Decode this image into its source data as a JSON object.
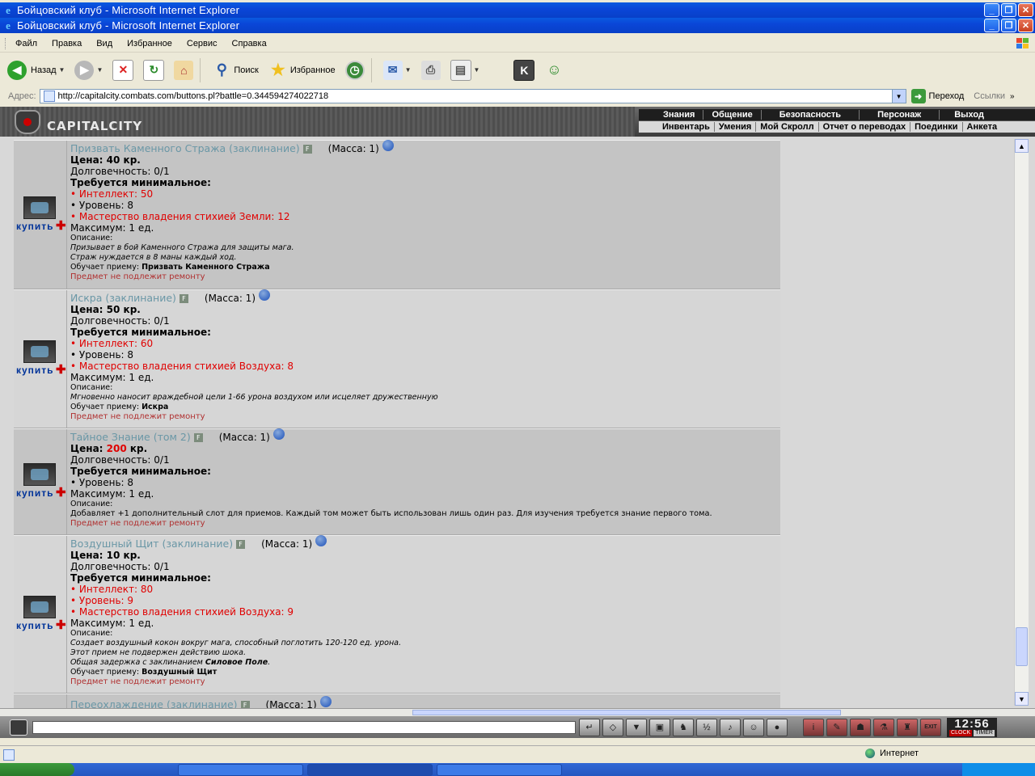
{
  "window": {
    "title1": "Бойцовский клуб - Microsoft Internet Explorer",
    "title2": "Бойцовский клуб - Microsoft Internet Explorer"
  },
  "menu": [
    "Файл",
    "Правка",
    "Вид",
    "Избранное",
    "Сервис",
    "Справка"
  ],
  "toolbar": {
    "back": "Назад",
    "search": "Поиск",
    "favorites": "Избранное"
  },
  "address": {
    "label": "Адрес:",
    "url": "http://capitalcity.combats.com/buttons.pl?battle=0.344594274022718",
    "go": "Переход",
    "links": "Ссылки"
  },
  "game": {
    "logo": "CAPITALCITY",
    "nav_top": [
      "Знания",
      "Общение",
      "Безопасность",
      "Персонаж",
      "Выход"
    ],
    "nav_bottom": [
      "Инвентарь",
      "Умения",
      "Мой Скролл",
      "Отчет о переводах",
      "Поединки",
      "Анкета"
    ]
  },
  "labels": {
    "buy": "купить",
    "mass": "(Масса: 1)",
    "price": "Цена:",
    "currency": "кр.",
    "durability": "Долговечность: 0/1",
    "required": "Требуется минимальное:",
    "max": "Максимум: 1 ед.",
    "description": "Описание:",
    "teaches": "Обучает приему:",
    "no_repair": "Предмет не подлежит ремонту",
    "f_badge": "F"
  },
  "items": [
    {
      "name": "Призвать Каменного Стража (заклинание)",
      "price": "40",
      "req1": "• Интеллект: 50",
      "req2": "• Уровень: 8",
      "req3": "• Мастерство владения стихией Земли: 12",
      "desc1": "Призывает в бой Каменного Стража для защиты мага.",
      "desc2": "Страж нуждается в 8 маны каждый ход.",
      "teaches": "Призвать Каменного Стража"
    },
    {
      "name": "Искра (заклинание)",
      "price": "50",
      "req1": "• Интеллект: 60",
      "req2": "• Уровень: 8",
      "req3": "• Мастерство владения стихией Воздуха: 8",
      "desc1": "Мгновенно наносит враждебной цели 1-66 урона воздухом или исцеляет дружественную",
      "teaches": "Искра"
    },
    {
      "name": "Тайное Знание (том 2)",
      "price": "200",
      "req1": "• Уровень: 8",
      "desc1": "Добавляет +1 дополнительный слот для приемов. Каждый том может быть использован лишь один раз. Для изучения требуется знание первого тома."
    },
    {
      "name": "Воздушный Щит (заклинание)",
      "price": "10",
      "req1": "• Интеллект: 80",
      "req2": "• Уровень: 9",
      "req3": "• Мастерство владения стихией Воздуха: 9",
      "desc1": "Создает воздушный кокон вокруг мага, способный поглотить 120-120 ед. урона.",
      "desc2": "Этот прием не подвержен действию шока.",
      "desc3_prefix": "Общая задержка с заклинанием",
      "desc3_bold": "Силовое Поле",
      "desc3_suffix": ".",
      "teaches": "Воздушный Щит"
    },
    {
      "name": "Переохлаждение (заклинание)"
    }
  ],
  "chat": {
    "exit": "EXIT",
    "time": "12:56",
    "clock": "CLOCK",
    "timer": "TIMER"
  },
  "status": {
    "zone": "Интернет"
  },
  "colors": {
    "title_bar": "#0a46d8",
    "item_link": "#6a97a6",
    "requirement_red": "#e00000",
    "buy_link": "#003399"
  }
}
